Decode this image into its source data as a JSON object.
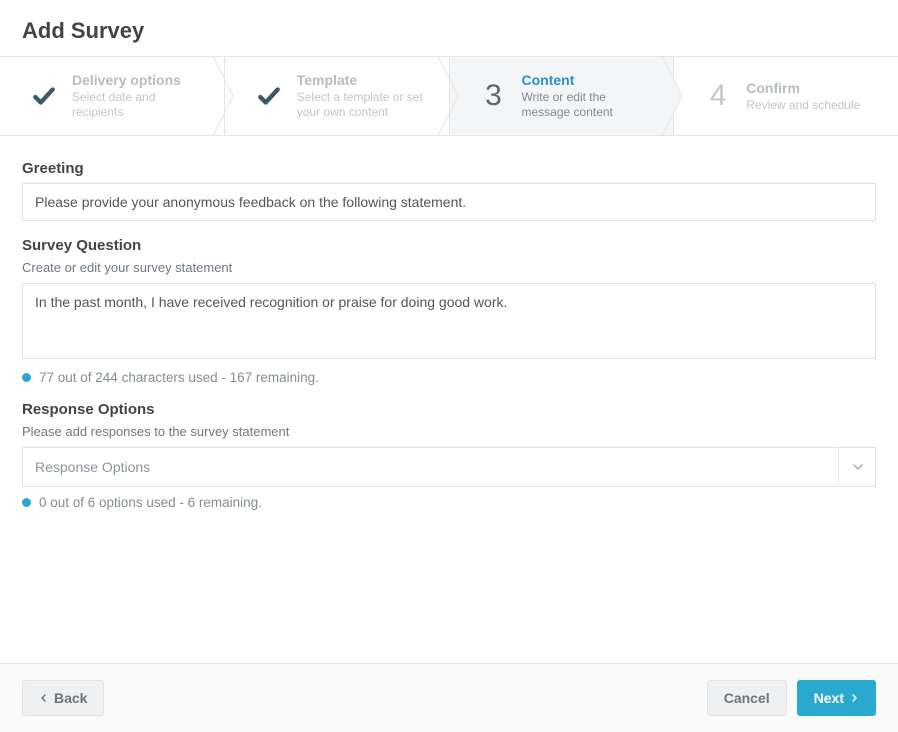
{
  "page": {
    "title": "Add Survey"
  },
  "stepper": [
    {
      "state": "done",
      "title": "Delivery options",
      "sub": "Select date and recipients"
    },
    {
      "state": "done",
      "title": "Template",
      "sub": "Select a template or set your own content"
    },
    {
      "state": "active",
      "number": "3",
      "title": "Content",
      "sub": "Write or edit the message content"
    },
    {
      "state": "pending",
      "number": "4",
      "title": "Confirm",
      "sub": "Review and schedule"
    }
  ],
  "form": {
    "greeting": {
      "label": "Greeting",
      "value": "Please provide your anonymous feedback on the following statement."
    },
    "question": {
      "label": "Survey Question",
      "help": "Create or edit your survey statement",
      "value": "In the past month, I have received recognition or praise for doing good work.",
      "counter": "77 out of 244 characters used - 167 remaining."
    },
    "responses": {
      "label": "Response Options",
      "help": "Please add responses to the survey statement",
      "placeholder": "Response Options",
      "counter": "0 out of 6 options used - 6 remaining."
    }
  },
  "footer": {
    "back": "Back",
    "cancel": "Cancel",
    "next": "Next"
  },
  "colors": {
    "accent": "#2aa9cf",
    "link": "#2a8fcf"
  }
}
